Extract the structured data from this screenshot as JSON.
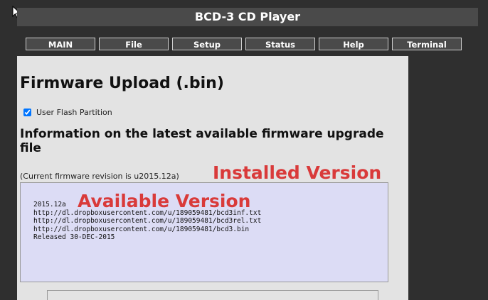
{
  "window": {
    "title": "BCD-3 CD Player"
  },
  "tabs": [
    {
      "label": "MAIN"
    },
    {
      "label": "File"
    },
    {
      "label": "Setup"
    },
    {
      "label": "Status"
    },
    {
      "label": "Help"
    },
    {
      "label": "Terminal"
    }
  ],
  "page": {
    "heading": "Firmware Upload (.bin)",
    "checkbox_label": "User Flash Partition",
    "checkbox_checked": true,
    "info_heading": "Information on the latest available firmware upgrade file",
    "current_revision": "(Current firmware revision is u2015.12a)",
    "annotation_installed": "Installed Version",
    "annotation_available": "Available Version",
    "code_lines": [
      "2015.12a",
      "http://dl.dropboxusercontent.com/u/189059481/bcd3inf.txt",
      "http://dl.dropboxusercontent.com/u/189059481/bcd3rel.txt",
      "http://dl.dropboxusercontent.com/u/189059481/bcd3.bin",
      "Released 30-DEC-2015"
    ]
  }
}
